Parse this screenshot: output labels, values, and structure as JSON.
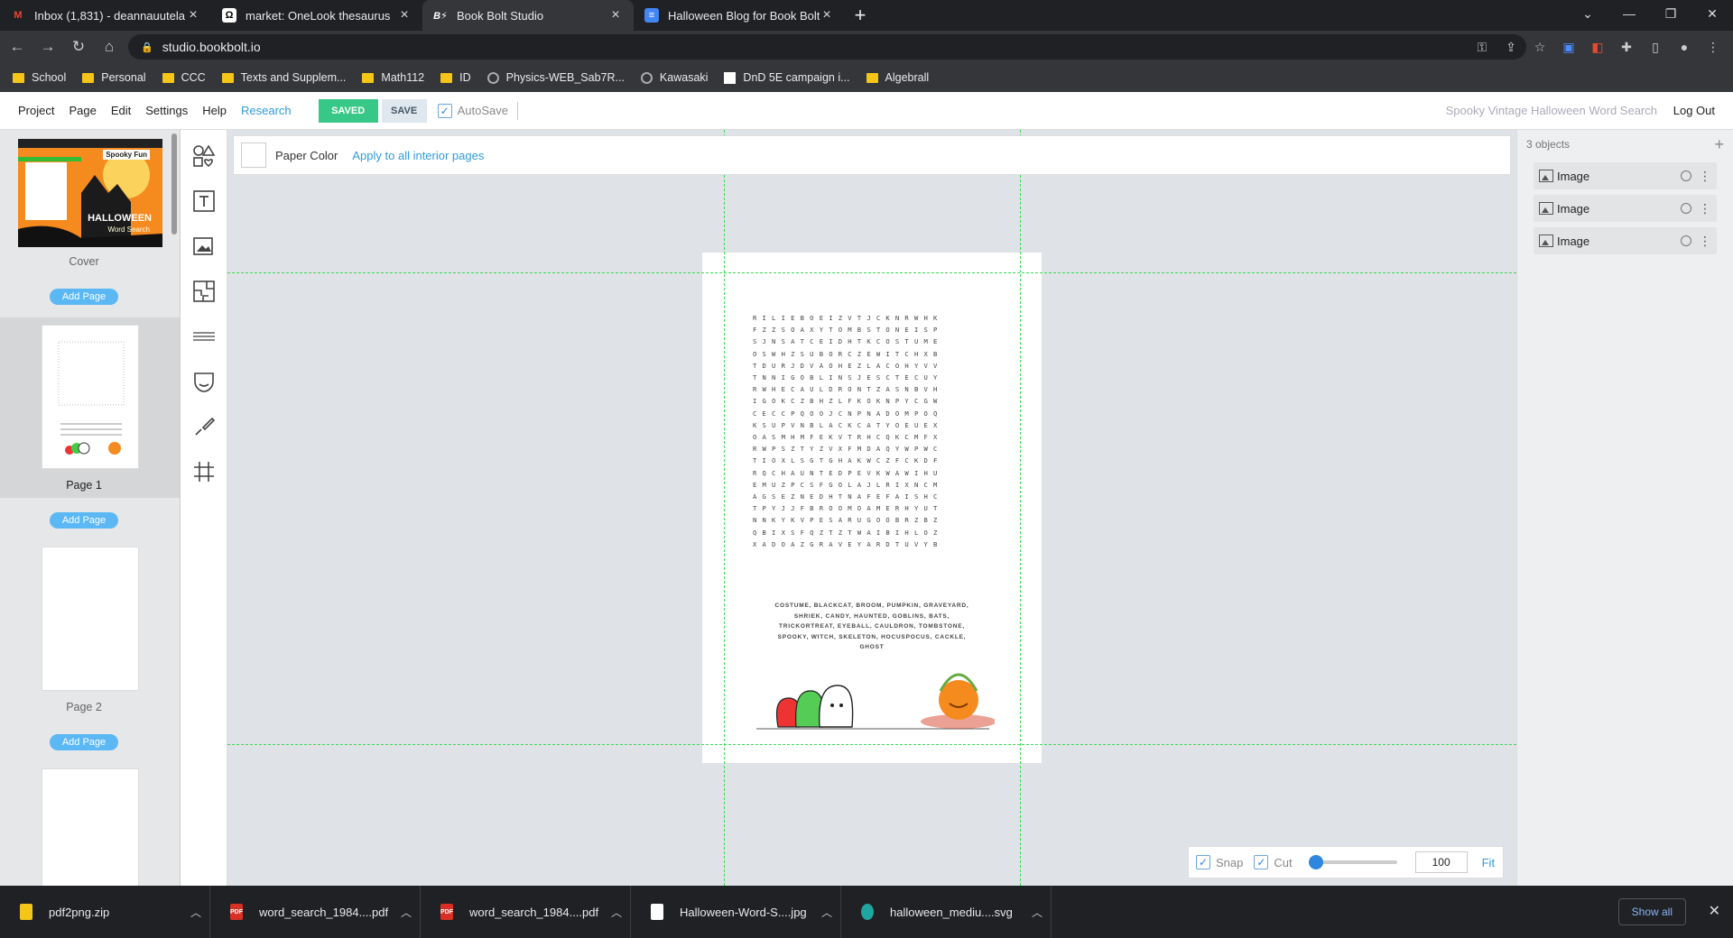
{
  "browser": {
    "tabs": [
      {
        "title": "Inbox (1,831) - deannauutela@gr",
        "icon": "gmail-icon",
        "active": false
      },
      {
        "title": "market: OneLook thesaurus",
        "icon": "onelook-icon",
        "active": false
      },
      {
        "title": "Book Bolt Studio",
        "icon": "bookbolt-icon",
        "active": true
      },
      {
        "title": "Halloween Blog for Book Bolt - G",
        "icon": "google-docs-icon",
        "active": false
      }
    ],
    "new_tab": "+",
    "url": "studio.bookbolt.io",
    "bookmarks": [
      {
        "label": "School",
        "type": "folder"
      },
      {
        "label": "Personal",
        "type": "folder"
      },
      {
        "label": "CCC",
        "type": "folder"
      },
      {
        "label": "Texts and Supplem...",
        "type": "folder"
      },
      {
        "label": "Math112",
        "type": "folder"
      },
      {
        "label": "ID",
        "type": "folder"
      },
      {
        "label": "Physics-WEB_Sab7R...",
        "type": "site"
      },
      {
        "label": "Kawasaki",
        "type": "site"
      },
      {
        "label": "DnD 5E campaign i...",
        "type": "site"
      },
      {
        "label": "Algebrall",
        "type": "folder"
      }
    ]
  },
  "app": {
    "menu": [
      "Project",
      "Page",
      "Edit",
      "Settings",
      "Help"
    ],
    "research": "Research",
    "saved": "SAVED",
    "save": "SAVE",
    "autosave": "AutoSave",
    "doc_title": "Spooky Vintage Halloween Word Search",
    "logout": "Log Out"
  },
  "pages_panel": {
    "pages": [
      {
        "label": "Cover"
      },
      {
        "label": "Page 1"
      },
      {
        "label": "Page 2"
      }
    ],
    "add_page": "Add Page",
    "cover_texts": {
      "tag": "Spooky Fun",
      "title1": "HALLOWEEN",
      "title2": "Word Search"
    }
  },
  "tools": [
    "shapes-icon",
    "text-icon",
    "image-icon",
    "puzzle-icon",
    "pattern-icon",
    "mask-icon",
    "brush-icon",
    "grid-icon"
  ],
  "workspace": {
    "paper_color": "Paper Color",
    "apply_all": "Apply to all interior pages",
    "word_grid": [
      "RILIEBOEIZVTJCKNRWHK",
      "FZZSOAXYTOMBSTONEISP",
      "SJNSATCEIDHTKCOSTUME",
      "OSWHZSUBORCZEWITCHXB",
      "TDURJDVAOHEZLACOHYVV",
      "TNNIGOBLINSJESCTECUY",
      "RWHECAULDRONTZASNBVH",
      "IGOKCZBHZLFKOKNPYCGW",
      "CECCPQOOJCNPNADOMPOQ",
      "KSUPVNBLACKCATYOEUEX",
      "OASMHMFEKVTRHCQKCMFX",
      "RWPSZTYZVXFMDAQYWPWC",
      "TIOXLSGTGHAKWCZFCKDF",
      "RQCHAUNTEDPEVKWAWIHU",
      "EMUZPCSFGOLAJLRIXNCM",
      "AGSEZNEDHTNAFEFAISHC",
      "TPYJJFBROOMOAMERHYUT",
      "NNKYKVPESARUGOOBRZBZ",
      "QBIXSFQZTZTWAIBIHLOZ",
      "XADOAZGRAVEYARDTUVYB"
    ],
    "word_list": "COSTUME, BLACKCAT, BROOM, PUMPKIN, GRAVEYARD, SHRIEK, CANDY, HAUNTED, GOBLINS, BATS, TRICKORTREAT, EYEBALL, CAULDRON, TOMBSTONE, SPOOKY, WITCH, SKELETON, HOCUSPOCUS, CACKLE, GHOST",
    "zoom": {
      "snap": "Snap",
      "cut": "Cut",
      "value": "100",
      "fit": "Fit",
      "level_fraction": 0.0
    }
  },
  "objects_panel": {
    "count": "3 objects",
    "items": [
      "Image",
      "Image",
      "Image"
    ]
  },
  "downloads": {
    "items": [
      {
        "name": "pdf2png.zip",
        "kind": "zip"
      },
      {
        "name": "word_search_1984....pdf",
        "kind": "pdf"
      },
      {
        "name": "word_search_1984....pdf",
        "kind": "pdf"
      },
      {
        "name": "Halloween-Word-S....jpg",
        "kind": "jpg"
      },
      {
        "name": "halloween_mediu....svg",
        "kind": "svg"
      }
    ],
    "show_all": "Show all"
  },
  "colors": {
    "accent": "#2e9bda",
    "saved_green": "#37c887",
    "guide_green": "#3adb56",
    "cover_orange": "#f58a1f"
  }
}
